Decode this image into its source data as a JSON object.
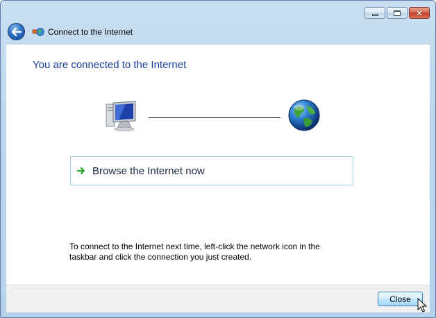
{
  "window": {
    "title": "Connect to the Internet",
    "caption_buttons": [
      "minimize",
      "maximize",
      "close"
    ]
  },
  "nav": {
    "back_icon": "back-arrow-icon",
    "title_icon": "network-connection-icon",
    "title": "Connect to the Internet"
  },
  "main": {
    "heading": "You are connected to the Internet",
    "diagram": {
      "left_icon": "computer-icon",
      "right_icon": "globe-icon"
    },
    "browse_link": {
      "icon": "green-arrow-icon",
      "label": "Browse the Internet now"
    },
    "footnote": "To connect to the Internet next time, left-click the network icon in the taskbar and click the connection you just created."
  },
  "footer": {
    "close_label": "Close"
  },
  "colors": {
    "heading": "#1a3e9c",
    "link_border": "#9ed3e6",
    "arrow": "#2aa52a"
  }
}
